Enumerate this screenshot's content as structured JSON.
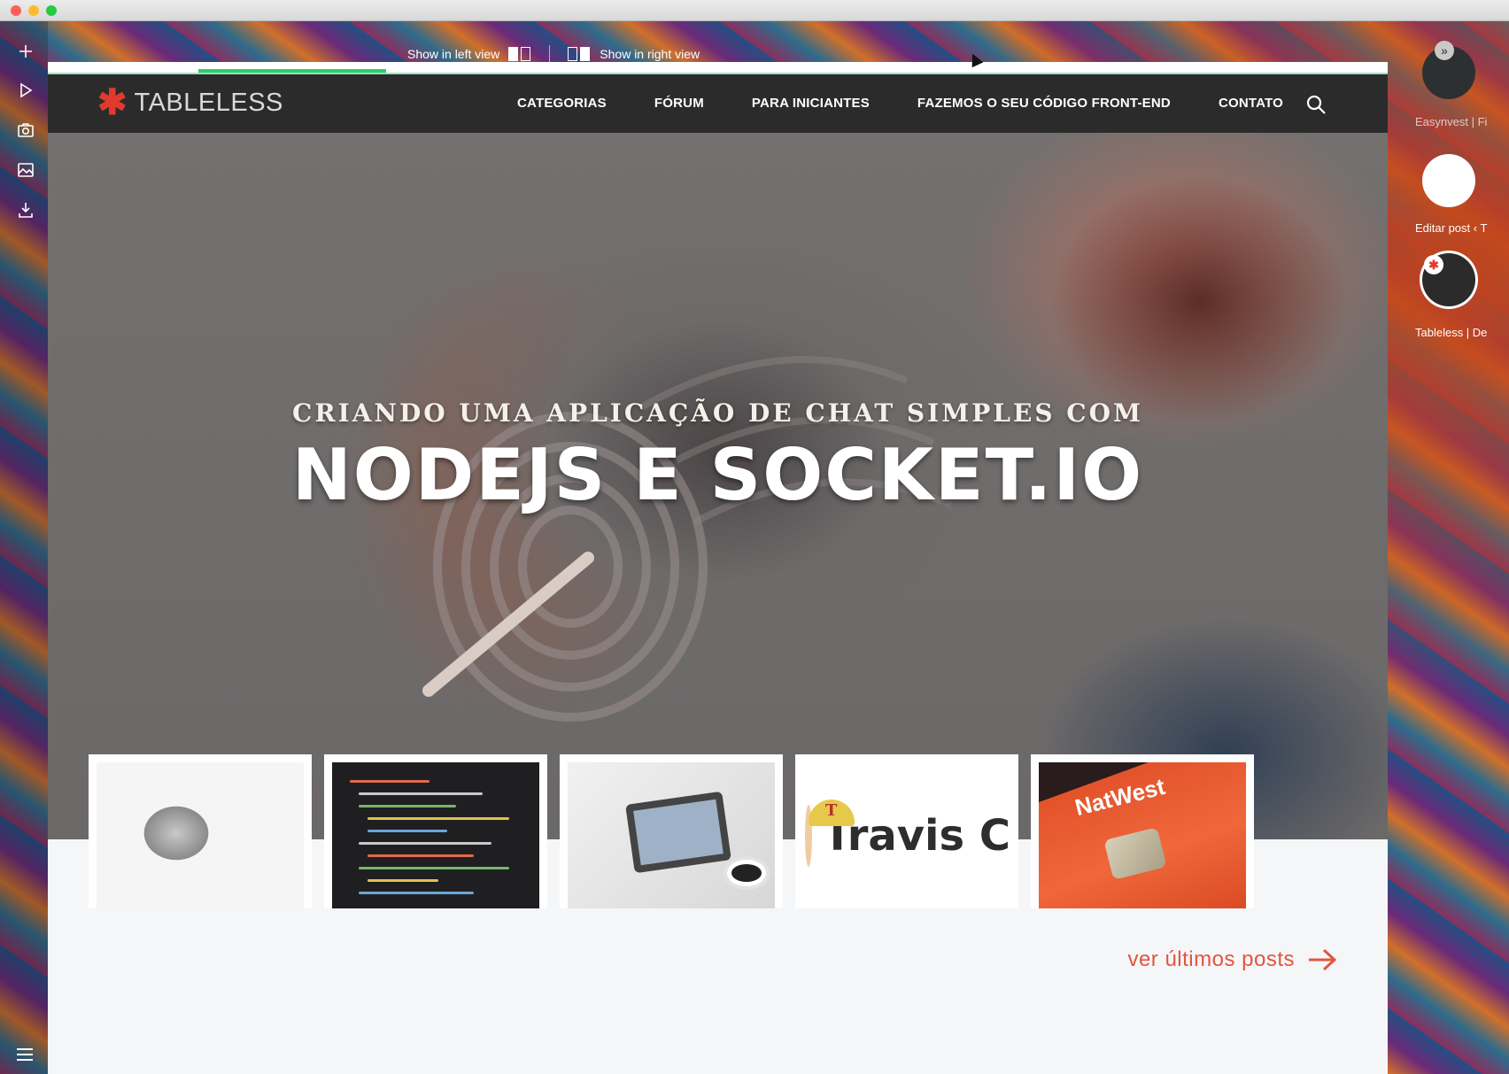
{
  "split_view": {
    "left_label": "Show in left view",
    "right_label": "Show in right view"
  },
  "site": {
    "logo_text": "TABLELESS",
    "nav": [
      {
        "label": "CATEGORIAS"
      },
      {
        "label": "FÓRUM"
      },
      {
        "label": "PARA INICIANTES"
      },
      {
        "label": "FAZEMOS O SEU CÓDIGO FRONT-END"
      },
      {
        "label": "CONTATO"
      }
    ],
    "page_progress": 0.14
  },
  "hero": {
    "subtitle": "CRIANDO UMA APLICAÇÃO DE CHAT SIMPLES COM",
    "title": "NODEJS E SOCKET.IO"
  },
  "thumbnails": {
    "travis_text": "Travis C",
    "card_brand": "NatWest"
  },
  "more_posts": {
    "label": "ver últimos posts"
  },
  "tab_previews": [
    {
      "label": "Easynvest | Fi"
    },
    {
      "label": "Editar post ‹ T"
    },
    {
      "label": "Tableless | De"
    }
  ],
  "colors": {
    "accent_red": "#e03a2f",
    "link": "#e2553f",
    "progress": "#2ecc71",
    "header": "#2b2b2b"
  },
  "icons": {
    "toolbar": [
      "plus-icon",
      "play-icon",
      "camera-icon",
      "image-icon",
      "download-icon",
      "menu-icon"
    ]
  }
}
